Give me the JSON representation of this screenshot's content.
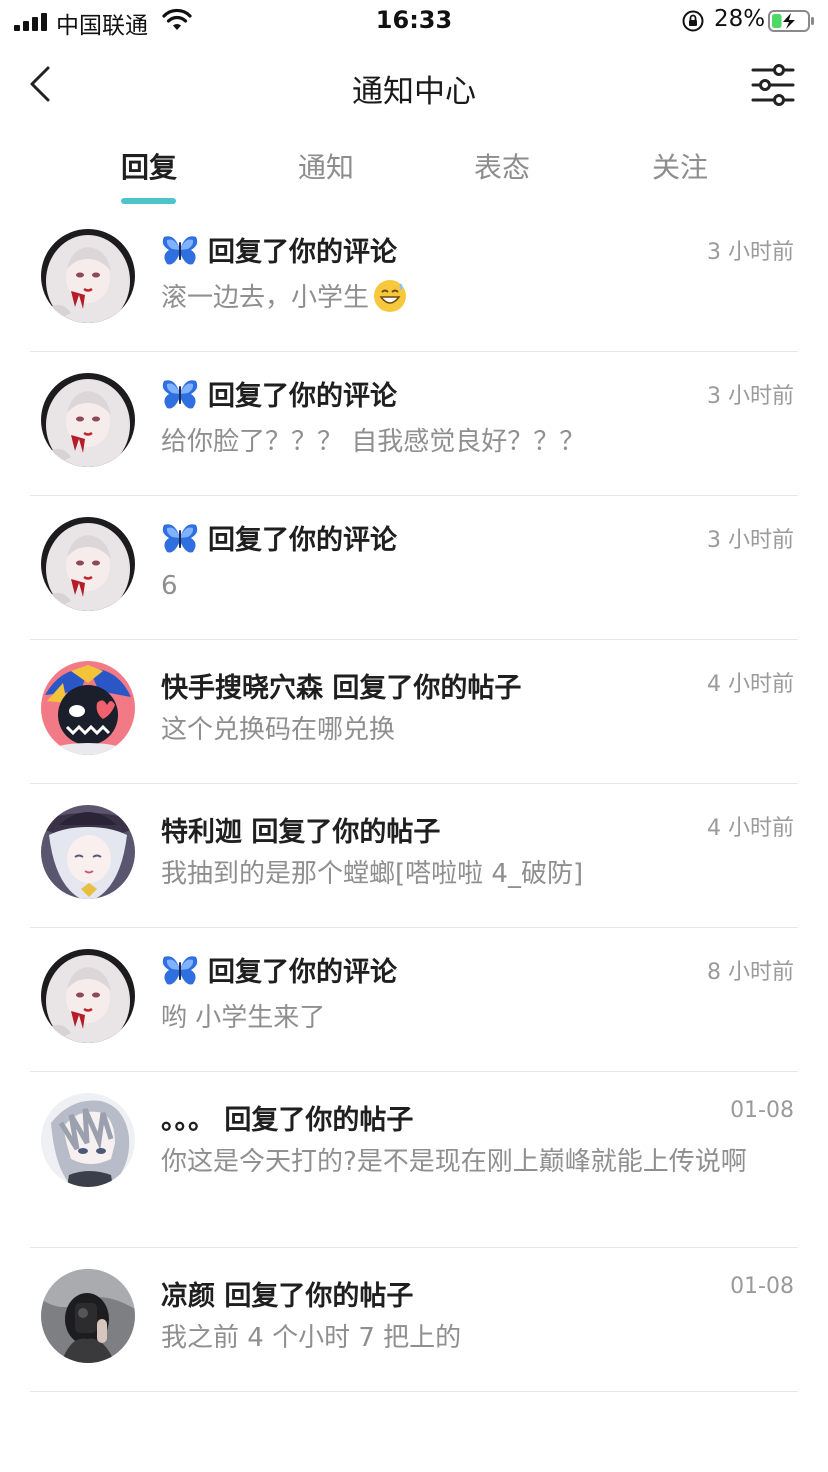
{
  "status_bar": {
    "carrier": "中国联通",
    "time": "16:33",
    "battery_percent": "28%",
    "battery_level": 0.28
  },
  "nav": {
    "title": "通知中心",
    "back_icon": "chevron-left-icon",
    "filter_icon": "sliders-icon"
  },
  "tabs": [
    {
      "label": "回复",
      "active": true
    },
    {
      "label": "通知",
      "active": false
    },
    {
      "label": "表态",
      "active": false
    },
    {
      "label": "关注",
      "active": false
    }
  ],
  "colors": {
    "accent": "#4dc4c9",
    "title_text": "#1f1f1f",
    "secondary_text": "#8f8f8f",
    "time_text": "#9a9a9a",
    "divider": "#e6e6e6"
  },
  "notifications": [
    {
      "user": "",
      "action": "回复了你的评论",
      "time": "3 小时前",
      "content": "滚一边去，小学生",
      "icon": "butterfly-icon",
      "emoji": "grinning-sweat-emoji"
    },
    {
      "user": "",
      "action": "回复了你的评论",
      "time": "3 小时前",
      "content": "给你脸了？？？ 自我感觉良好？？？",
      "icon": "butterfly-icon"
    },
    {
      "user": "",
      "action": "回复了你的评论",
      "time": "3 小时前",
      "content": "6",
      "icon": "butterfly-icon"
    },
    {
      "user": "快手搜晓穴森",
      "action": "回复了你的帖子",
      "time": "4 小时前",
      "content": "这个兑换码在哪兑换"
    },
    {
      "user": "特利迦",
      "action": "回复了你的帖子",
      "time": "4 小时前",
      "content": "我抽到的是那个螳螂[嗒啦啦 4_破防]"
    },
    {
      "user": "",
      "action": "回复了你的评论",
      "time": "8 小时前",
      "content": "哟 小学生来了",
      "icon": "butterfly-icon"
    },
    {
      "user": "。。。",
      "action": "回复了你的帖子",
      "time": "01-08",
      "content": "你这是今天打的?是不是现在刚上巅峰就能上传说啊"
    },
    {
      "user": "凉颜",
      "action": "回复了你的帖子",
      "time": "01-08",
      "content": "我之前 4 个小时 7 把上的"
    }
  ]
}
